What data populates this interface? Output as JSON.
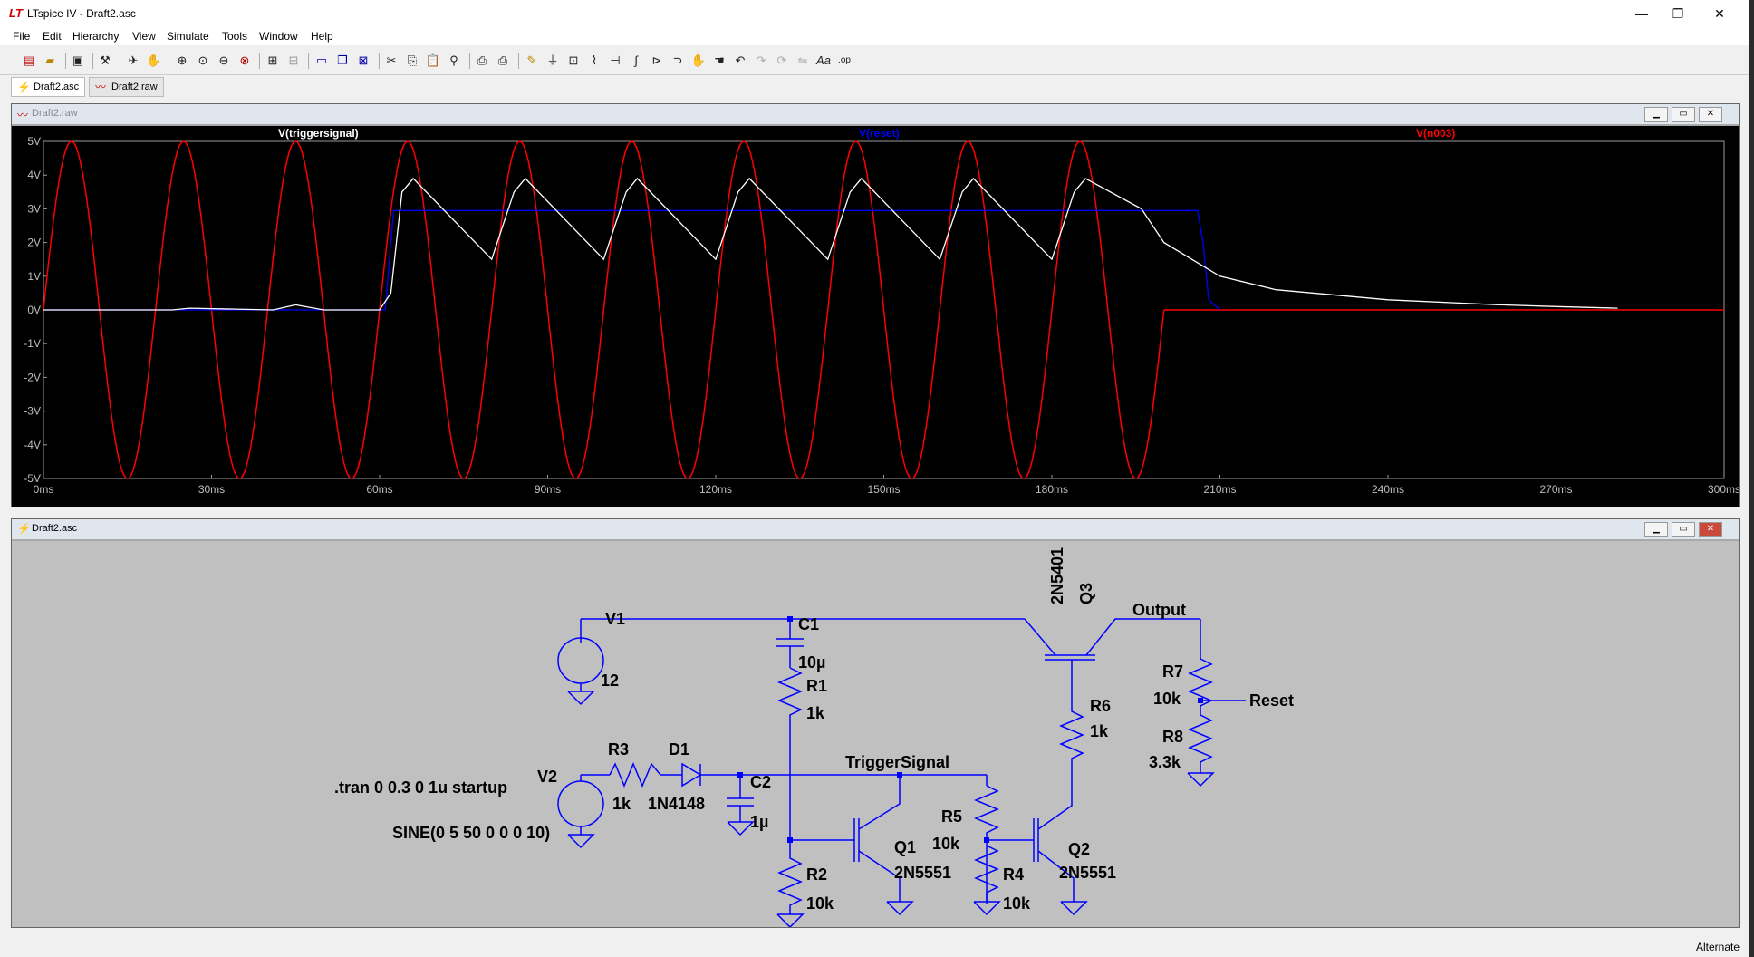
{
  "window": {
    "title": "LTspice IV - Draft2.asc",
    "app_icon": "LT",
    "min": "—",
    "max": "❐",
    "close": "✕"
  },
  "menu": [
    "File",
    "Edit",
    "Hierarchy",
    "View",
    "Simulate",
    "Tools",
    "Window",
    "Help"
  ],
  "tabs": [
    {
      "label": "Draft2.asc",
      "icon": "schematic-icon"
    },
    {
      "label": "Draft2.raw",
      "icon": "waveform-icon"
    }
  ],
  "waveform_window": {
    "title": "Draft2.raw",
    "traces": [
      {
        "label": "V(triggersignal)",
        "color": "#ffffff"
      },
      {
        "label": "V(reset)",
        "color": "#0000ff"
      },
      {
        "label": "V(n003)",
        "color": "#ff0000"
      }
    ]
  },
  "schematic_window": {
    "title": "Draft2.asc"
  },
  "schematic": {
    "V1": "V1",
    "V1_val": "12",
    "V2": "V2",
    "V2_val": "SINE(0 5 50 0 0 0 10)",
    "tran": ".tran 0 0.3 0 1u startup",
    "R3": "R3",
    "R3_val": "1k",
    "D1": "D1",
    "D1_val": "1N4148",
    "C1": "C1",
    "C1_val": "10µ",
    "C2": "C2",
    "C2_val": "1µ",
    "R1": "R1",
    "R1_val": "1k",
    "R2": "R2",
    "R2_val": "10k",
    "Q1": "Q1",
    "Q1_val": "2N5551",
    "R5": "R5",
    "R5_val": "10k",
    "R4": "R4",
    "R4_val": "10k",
    "Q2": "Q2",
    "Q2_val": "2N5551",
    "Q3": "Q3",
    "Q3_val": "2N5401",
    "R6": "R6",
    "R6_val": "1k",
    "R7": "R7",
    "R7_val": "10k",
    "R8": "R8",
    "R8_val": "3.3k",
    "net_output": "Output",
    "net_trigger": "TriggerSignal",
    "net_reset": "Reset"
  },
  "status": "Alternate",
  "chart_data": {
    "type": "line",
    "xlabel": "",
    "ylabel": "",
    "xlim": [
      0,
      300
    ],
    "ylim": [
      -5,
      5
    ],
    "x_ticks": [
      "0ms",
      "30ms",
      "60ms",
      "90ms",
      "120ms",
      "150ms",
      "180ms",
      "210ms",
      "240ms",
      "270ms",
      "300ms"
    ],
    "y_ticks": [
      "5V",
      "4V",
      "3V",
      "2V",
      "1V",
      "0V",
      "-1V",
      "-2V",
      "-3V",
      "-4V",
      "-5V"
    ],
    "grid": false,
    "series": [
      {
        "name": "V(triggersignal)",
        "color": "#ffffff",
        "x": [
          0,
          23,
          26,
          41,
          45,
          50,
          60,
          62,
          64,
          66,
          80,
          82,
          84,
          86,
          100,
          102,
          104,
          106,
          120,
          122,
          124,
          126,
          140,
          142,
          144,
          146,
          160,
          162,
          164,
          166,
          180,
          182,
          184,
          186,
          196,
          200,
          210,
          220,
          240,
          260,
          270,
          281
        ],
        "y": [
          0,
          0,
          0.05,
          0,
          0.15,
          0,
          0,
          0.5,
          3.5,
          3.9,
          1.5,
          2.5,
          3.5,
          3.9,
          1.5,
          2.5,
          3.5,
          3.9,
          1.5,
          2.5,
          3.5,
          3.9,
          1.5,
          2.5,
          3.5,
          3.9,
          1.5,
          2.5,
          3.5,
          3.9,
          1.5,
          2.5,
          3.5,
          3.9,
          3.0,
          2.0,
          1.0,
          0.6,
          0.3,
          0.15,
          0.1,
          0.05
        ]
      },
      {
        "name": "V(reset)",
        "color": "#0000ff",
        "x": [
          0,
          61,
          62,
          62.5,
          206,
          207,
          208,
          210
        ],
        "y": [
          0,
          0,
          2.0,
          2.95,
          2.95,
          2.0,
          0.3,
          0
        ]
      },
      {
        "name": "V(n003)",
        "color": "#ff0000",
        "function": "5*sin(2*pi*50*t)",
        "x_start": 0,
        "x_end": 200,
        "x_after": [
          200,
          300
        ],
        "y_after": 0
      }
    ]
  }
}
